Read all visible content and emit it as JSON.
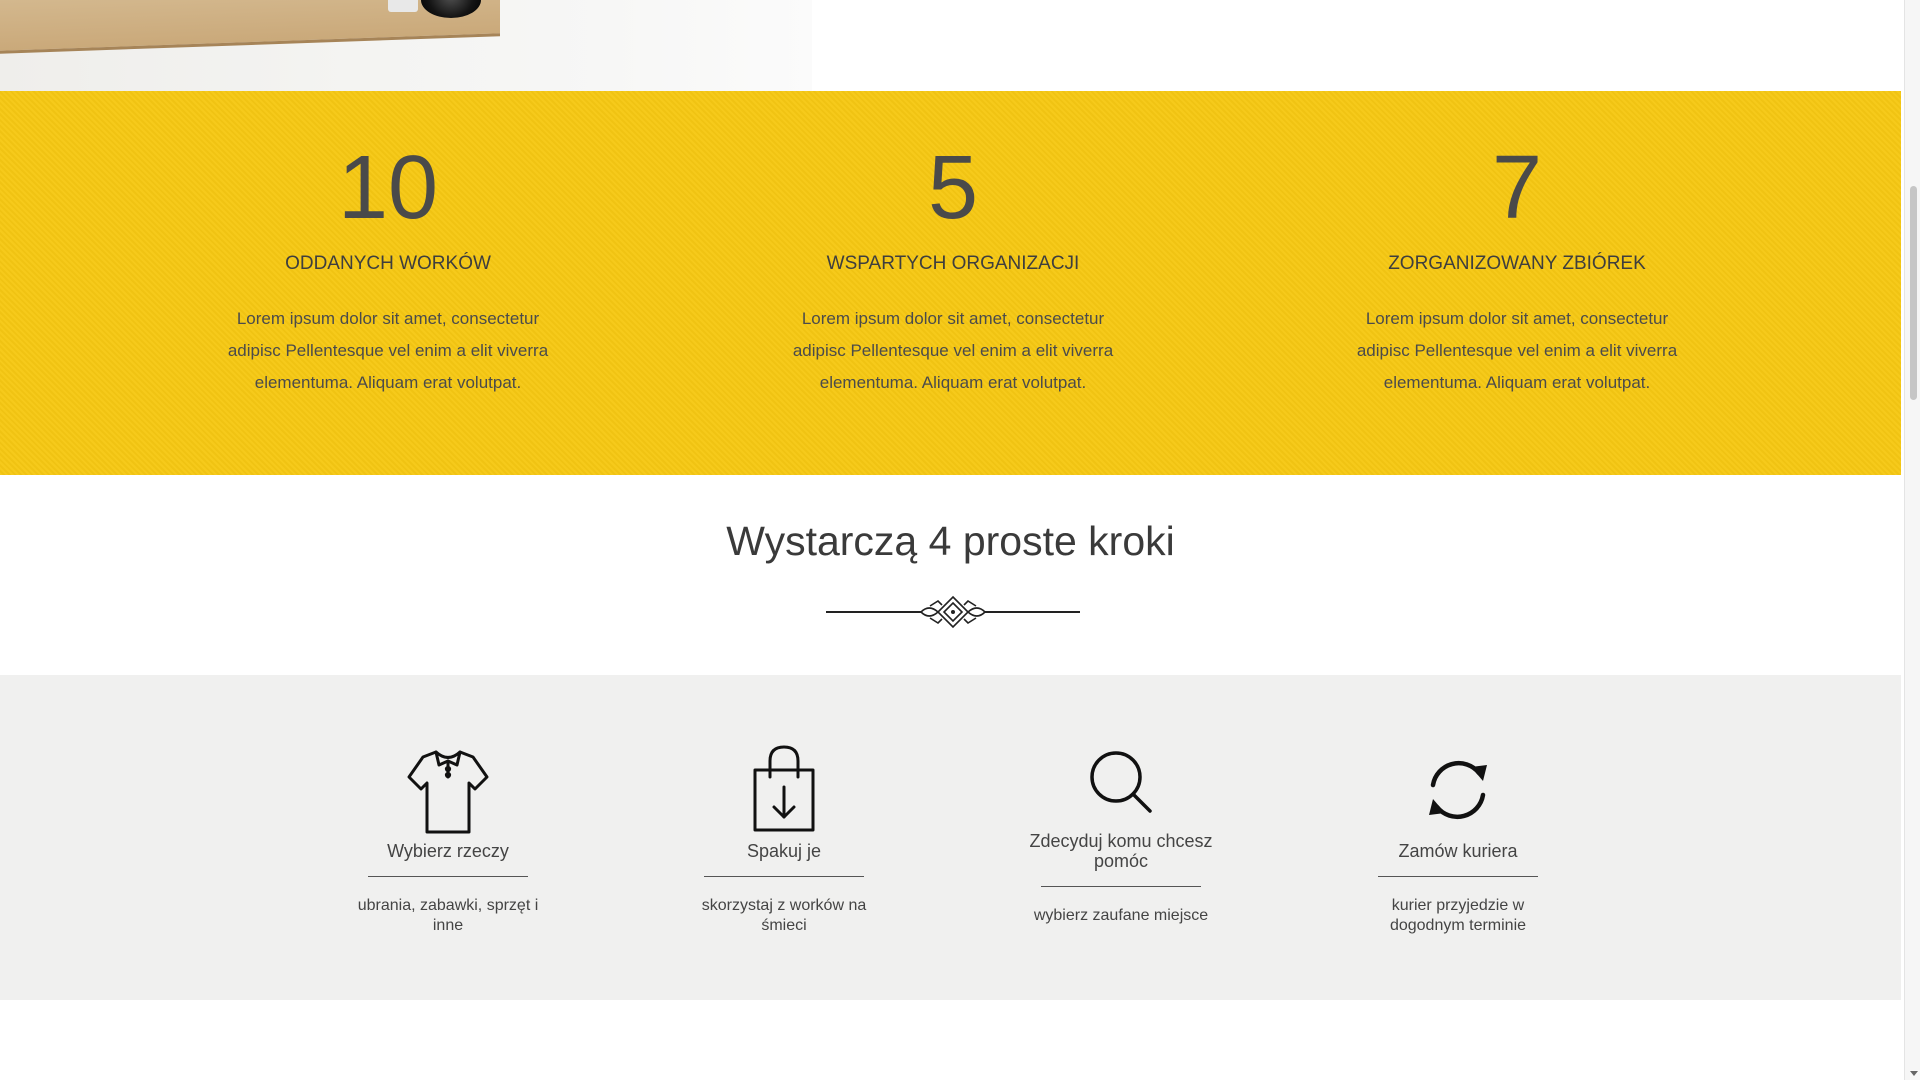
{
  "stats": [
    {
      "number": "10",
      "title": "ODDANYCH WORKÓW",
      "text": "Lorem ipsum dolor sit amet, consectetur adipisc Pellentesque vel enim a elit viverra elementuma. Aliquam erat volutpat."
    },
    {
      "number": "5",
      "title": "WSPARTYCH ORGANIZACJI",
      "text": "Lorem ipsum dolor sit amet, consectetur adipisc Pellentesque vel enim a elit viverra elementuma. Aliquam erat volutpat."
    },
    {
      "number": "7",
      "title": "ZORGANIZOWANY ZBIÓREK",
      "text": "Lorem ipsum dolor sit amet, consectetur adipisc Pellentesque vel enim a elit viverra elementuma. Aliquam erat volutpat."
    }
  ],
  "steps_section": {
    "title": "Wystarczą 4 proste kroki",
    "ornament_icon": "decorative-divider-icon"
  },
  "steps": [
    {
      "icon": "shirt-icon",
      "title": "Wybierz rzeczy",
      "desc": "ubrania, zabawki, sprzęt i inne"
    },
    {
      "icon": "bag-download-icon",
      "title": "Spakuj je",
      "desc": "skorzystaj z worków na śmieci"
    },
    {
      "icon": "search-icon",
      "title": "Zdecyduj komu chcesz pomóc",
      "desc": "wybierz zaufane miejsce"
    },
    {
      "icon": "refresh-icon",
      "title": "Zamów kuriera",
      "desc": "kurier przyjedzie w dogodnym terminie"
    }
  ],
  "colors": {
    "accent_yellow": "#f6c813",
    "grey_band": "#f0f0ef",
    "text_dark": "#3c3c3c"
  }
}
